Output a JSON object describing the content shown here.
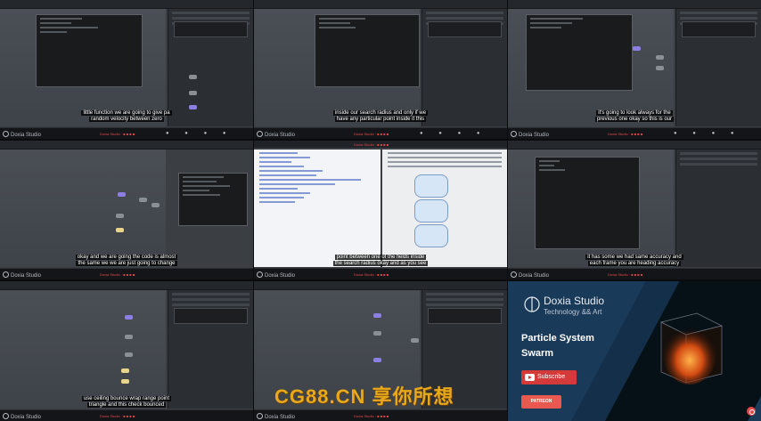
{
  "cells": [
    {
      "subtitle": [
        "little function we are going to give pa",
        "random velocity between zero"
      ]
    },
    {
      "subtitle": [
        "inside our search radius and only if we",
        "have any particular point inside it this"
      ]
    },
    {
      "subtitle": [
        "it's going to look always for the",
        "previous one okay so this is our"
      ]
    },
    {
      "subtitle": [
        "okay and we are going the code is almost",
        "the same we we are just going to change"
      ]
    },
    {
      "subtitle": [
        "point between one of the fields inside",
        "the search radius okay and as you see"
      ]
    },
    {
      "subtitle": [
        "it has some we had same accuracy and",
        "each frame you are heading accuracy"
      ]
    },
    {
      "subtitle": [
        "use ceiling bounce wrap range point",
        "triangle and this check bounced"
      ]
    },
    {
      "subtitle": []
    }
  ],
  "taskbar": {
    "brand": "Doxia Studio",
    "red_text": "Doxia Studio · ■ ■ ■ ■",
    "icons": "● ● ● ●"
  },
  "promo": {
    "brand_name": "Doxia Studio",
    "brand_sub": "Technology && Art",
    "title_line1": "Particle System",
    "title_line2": "Swarm",
    "subscribe_label": "Subscribe",
    "patreon_label": "PATREON"
  },
  "watermark": "CG88.CN 享你所想",
  "colors": {
    "node_purple": "#8b7fe3",
    "node_yellow": "#e8d58b",
    "subscribe_red": "#d53a3a",
    "patreon_red": "#e9594f",
    "watermark_gold": "#e7a81c"
  }
}
